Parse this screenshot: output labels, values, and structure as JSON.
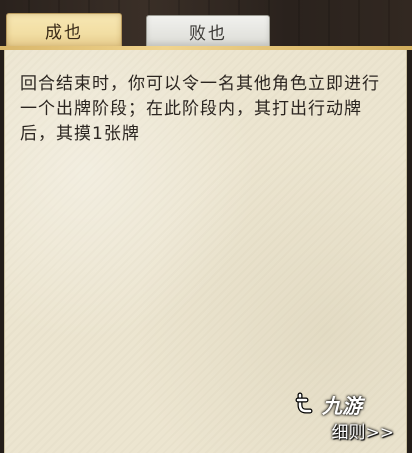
{
  "tabs": [
    {
      "label": "成也",
      "active": true
    },
    {
      "label": "败也",
      "active": false
    }
  ],
  "description": "回合结束时，你可以令一名其他角色立即进行一个出牌阶段；在此阶段内，其打出行动牌后，其摸1张牌",
  "details_link": "细则>>",
  "watermark": {
    "text": "九游",
    "icon": "jiuyou-logo-icon"
  },
  "colors": {
    "active_tab": "#f2dea3",
    "inactive_tab": "#dcdcd6",
    "panel": "#ece5d0",
    "frame": "#231d19"
  }
}
